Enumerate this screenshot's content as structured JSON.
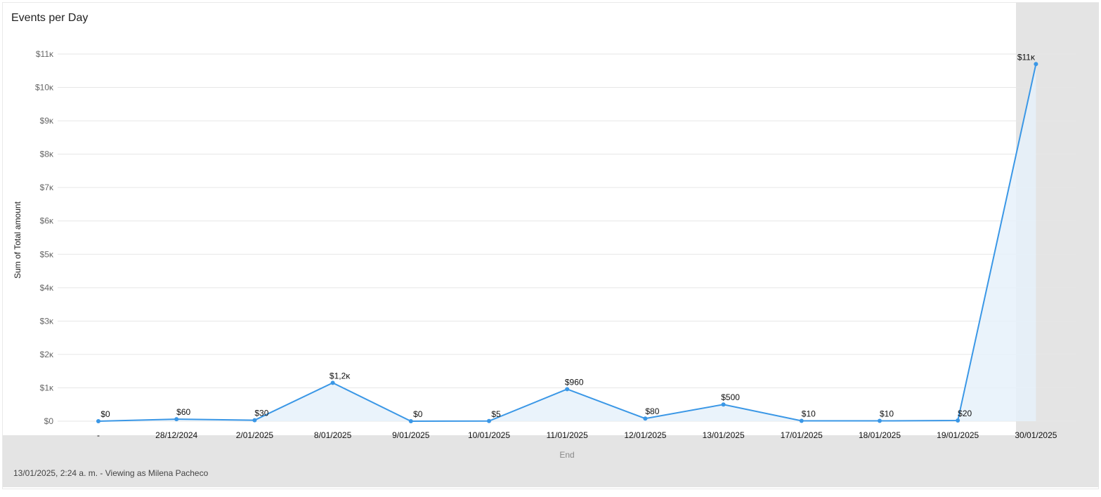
{
  "chart_data": {
    "type": "area",
    "title": "Events per Day",
    "xlabel": "End",
    "ylabel": "Sum of Total amount",
    "ylim": [
      0,
      11000
    ],
    "yticks": [
      0,
      1000,
      2000,
      3000,
      4000,
      5000,
      6000,
      7000,
      8000,
      9000,
      10000,
      11000
    ],
    "ytick_labels": [
      "$0",
      "$1κ",
      "$2κ",
      "$3κ",
      "$4κ",
      "$5κ",
      "$6κ",
      "$7κ",
      "$8κ",
      "$9κ",
      "$10κ",
      "$11κ"
    ],
    "categories": [
      "-",
      "28/12/2024",
      "2/01/2025",
      "8/01/2025",
      "9/01/2025",
      "10/01/2025",
      "11/01/2025",
      "12/01/2025",
      "13/01/2025",
      "17/01/2025",
      "18/01/2025",
      "19/01/2025",
      "30/01/2025"
    ],
    "values": [
      0,
      60,
      30,
      1150,
      0,
      5,
      960,
      80,
      500,
      10,
      10,
      20,
      10700
    ],
    "data_labels": [
      "$0",
      "$60",
      "$30",
      "$1,2κ",
      "$0",
      "$5",
      "$960",
      "$80",
      "$500",
      "$10",
      "$10",
      "$20",
      "$11κ"
    ],
    "grid": true,
    "highlighted_category": "30/01/2025",
    "line_color": "#3a97e6",
    "fill_color": "#e6f1fa",
    "highlight_band_color": "#e4e4e4"
  },
  "footer": {
    "text": "13/01/2025, 2:24 a. m. - Viewing as Milena Pacheco"
  }
}
